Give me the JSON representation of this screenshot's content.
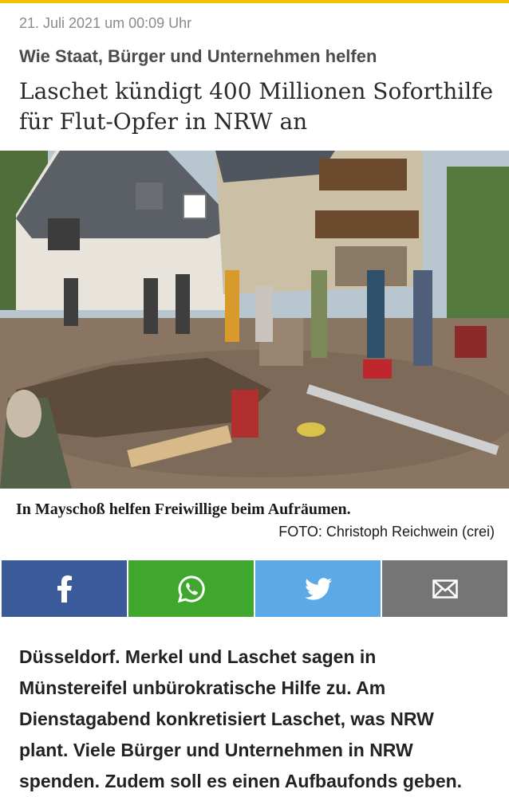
{
  "article": {
    "date": "21. Juli 2021 um 00:09 Uhr",
    "kicker": "Wie Staat, Bürger und Unternehmen helfen",
    "headline_line1": "Laschet kündigt 400 Millionen Soforthilfe",
    "headline_line2": "für Flut-Opfer in NRW an",
    "caption": "In Mayschoß helfen Freiwillige beim Aufräumen.",
    "credit": "FOTO: Christoph Reichwein (crei)",
    "teaser_line1": "Düsseldorf.  Merkel und Laschet sagen in",
    "teaser_line2": "Münstereifel unbürokratische Hilfe zu. Am",
    "teaser_line3": "Dienstagabend konkretisiert Laschet, was NRW",
    "teaser_line4": "plant. Viele Bürger und Unternehmen in NRW",
    "teaser_line5": "spenden. Zudem soll es einen Aufbaufonds geben."
  },
  "share": [
    {
      "icon": "facebook-icon",
      "color": "#3a5a99"
    },
    {
      "icon": "whatsapp-icon",
      "color": "#3fa72d"
    },
    {
      "icon": "twitter-icon",
      "color": "#5ca9e8"
    },
    {
      "icon": "mail-icon",
      "color": "#757575"
    }
  ],
  "colors": {
    "accent": "#f5c200"
  }
}
